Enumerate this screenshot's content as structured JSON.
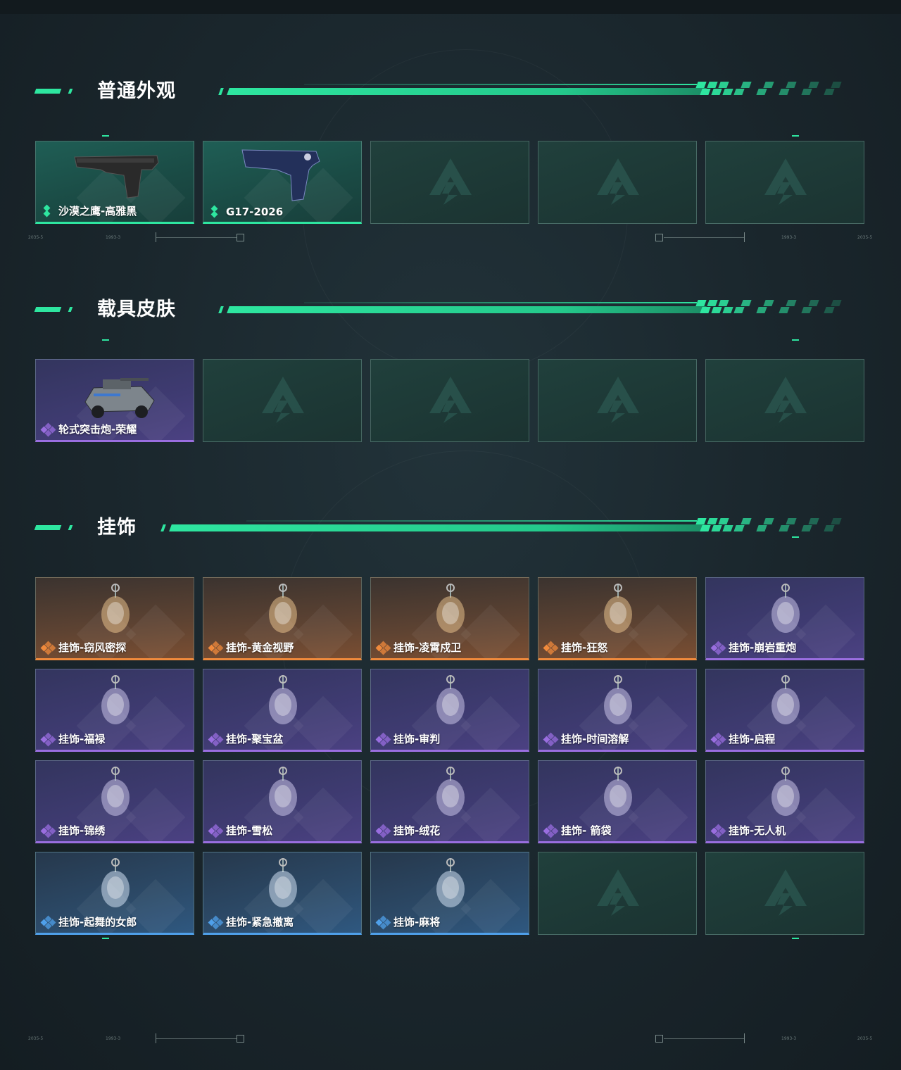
{
  "sections": [
    {
      "title": "普通外观",
      "items": [
        {
          "label": "沙漠之鹰-高雅黑",
          "rarity": "green",
          "icon": "desert-eagle-pistol-icon"
        },
        {
          "label": "G17-2026",
          "rarity": "green",
          "icon": "g17-pistol-icon"
        },
        {
          "empty": true
        },
        {
          "empty": true
        },
        {
          "empty": true
        }
      ]
    },
    {
      "title": "载具皮肤",
      "items": [
        {
          "label": "轮式突击炮-荣耀",
          "rarity": "purple",
          "icon": "armored-vehicle-icon"
        },
        {
          "empty": true
        },
        {
          "empty": true
        },
        {
          "empty": true
        },
        {
          "empty": true
        }
      ]
    },
    {
      "title": "挂饰",
      "items": [
        {
          "label": "挂饰-窃风密探",
          "rarity": "orange",
          "icon": "white-figure-charm-icon"
        },
        {
          "label": "挂饰-黄金视野",
          "rarity": "orange",
          "icon": "fox-figure-charm-icon"
        },
        {
          "label": "挂饰-凌霄戍卫",
          "rarity": "orange",
          "icon": "guardian-charm-icon"
        },
        {
          "label": "挂饰-狂怒",
          "rarity": "orange",
          "icon": "fury-charm-icon"
        },
        {
          "label": "挂饰-崩岩重炮",
          "rarity": "purple",
          "icon": "rock-cannon-charm-icon"
        },
        {
          "label": "挂饰-福禄",
          "rarity": "purple",
          "icon": "gourd-charm-icon"
        },
        {
          "label": "挂饰-聚宝盆",
          "rarity": "purple",
          "icon": "treasure-bowl-charm-icon"
        },
        {
          "label": "挂饰-审判",
          "rarity": "purple",
          "icon": "judgement-card-charm-icon"
        },
        {
          "label": "挂饰-时间溶解",
          "rarity": "purple",
          "icon": "melting-clock-charm-icon"
        },
        {
          "label": "挂饰-启程",
          "rarity": "purple",
          "icon": "compass-ring-charm-icon"
        },
        {
          "label": "挂饰-锦绣",
          "rarity": "purple",
          "icon": "butterfly-charm-icon"
        },
        {
          "label": "挂饰-雪松",
          "rarity": "purple",
          "icon": "snow-pine-charm-icon"
        },
        {
          "label": "挂饰-绒花",
          "rarity": "purple",
          "icon": "red-flower-charm-icon"
        },
        {
          "label": "挂饰- 箭袋",
          "rarity": "purple",
          "icon": "quiver-charm-icon"
        },
        {
          "label": "挂饰-无人机",
          "rarity": "purple",
          "icon": "drone-charm-icon"
        },
        {
          "label": "挂饰-起舞的女郎",
          "rarity": "blue",
          "icon": "dancer-charm-icon"
        },
        {
          "label": "挂饰-紧急撤离",
          "rarity": "blue",
          "icon": "evac-tag-charm-icon"
        },
        {
          "label": "挂饰-麻将",
          "rarity": "blue",
          "icon": "mahjong-tile-charm-icon"
        },
        {
          "empty": true
        },
        {
          "empty": true
        }
      ]
    }
  ],
  "colors": {
    "accent": "#2ee6a0",
    "green": "#2ee6a0",
    "purple": "#9a6ee0",
    "orange": "#f08a3c",
    "blue": "#4fa0ea",
    "empty_logo": "#2c5a52"
  },
  "frame_codes": {
    "left_a": "2035-5",
    "left_b": "1993-3",
    "right_a": "1993-3",
    "right_b": "2035-5"
  }
}
